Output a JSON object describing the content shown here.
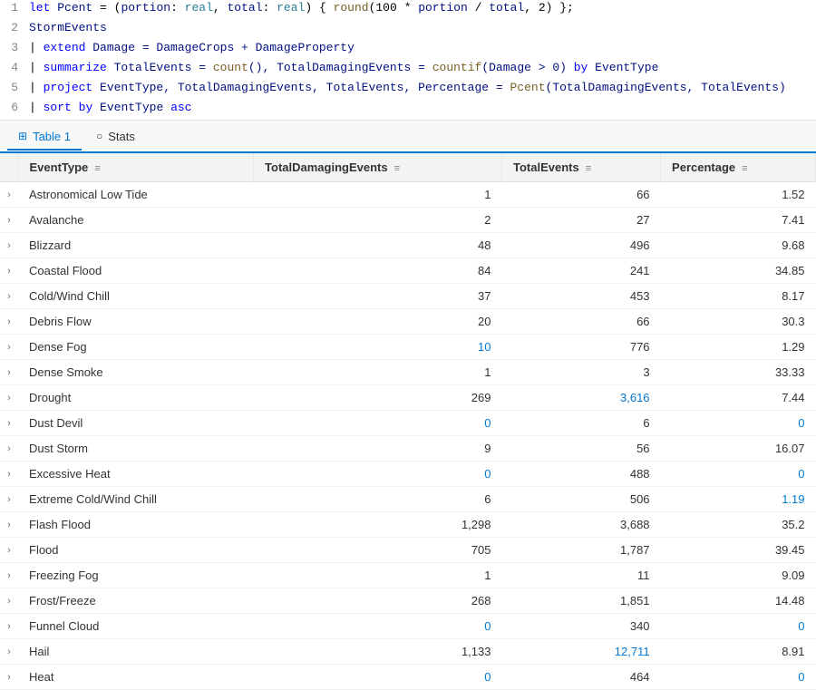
{
  "editor": {
    "lines": [
      {
        "num": 1,
        "tokens": [
          {
            "text": "let ",
            "cls": "keyword"
          },
          {
            "text": "Pcent",
            "cls": "identifier"
          },
          {
            "text": " = (",
            "cls": "op"
          },
          {
            "text": "portion",
            "cls": "param"
          },
          {
            "text": ": ",
            "cls": "op"
          },
          {
            "text": "real",
            "cls": "type"
          },
          {
            "text": ", ",
            "cls": "op"
          },
          {
            "text": "total",
            "cls": "param"
          },
          {
            "text": ": ",
            "cls": "op"
          },
          {
            "text": "real",
            "cls": "type"
          },
          {
            "text": ") { ",
            "cls": "op"
          },
          {
            "text": "round",
            "cls": "fn"
          },
          {
            "text": "(100 * ",
            "cls": "op"
          },
          {
            "text": "portion",
            "cls": "param"
          },
          {
            "text": " / ",
            "cls": "op"
          },
          {
            "text": "total",
            "cls": "param"
          },
          {
            "text": ", 2) };",
            "cls": "op"
          }
        ]
      },
      {
        "num": 2,
        "tokens": [
          {
            "text": "StormEvents",
            "cls": "identifier"
          }
        ]
      },
      {
        "num": 3,
        "tokens": [
          {
            "text": "| ",
            "cls": "pipe"
          },
          {
            "text": "extend",
            "cls": "keyword"
          },
          {
            "text": " Damage = DamageCrops + DamageProperty",
            "cls": "identifier"
          }
        ]
      },
      {
        "num": 4,
        "tokens": [
          {
            "text": "| ",
            "cls": "pipe"
          },
          {
            "text": "summarize",
            "cls": "keyword"
          },
          {
            "text": " TotalEvents = ",
            "cls": "identifier"
          },
          {
            "text": "count",
            "cls": "fn"
          },
          {
            "text": "(), TotalDamagingEvents = ",
            "cls": "identifier"
          },
          {
            "text": "countif",
            "cls": "fn"
          },
          {
            "text": "(Damage > 0) ",
            "cls": "identifier"
          },
          {
            "text": "by",
            "cls": "keyword"
          },
          {
            "text": " EventType",
            "cls": "identifier"
          }
        ]
      },
      {
        "num": 5,
        "tokens": [
          {
            "text": "| ",
            "cls": "pipe"
          },
          {
            "text": "project",
            "cls": "keyword"
          },
          {
            "text": " EventType, TotalDamagingEvents, TotalEvents, Percentage = ",
            "cls": "identifier"
          },
          {
            "text": "Pcent",
            "cls": "fn"
          },
          {
            "text": "(TotalDamagingEvents, TotalEvents)",
            "cls": "identifier"
          }
        ]
      },
      {
        "num": 6,
        "tokens": [
          {
            "text": "| ",
            "cls": "pipe"
          },
          {
            "text": "sort",
            "cls": "keyword"
          },
          {
            "text": " ",
            "cls": "op"
          },
          {
            "text": "by",
            "cls": "keyword"
          },
          {
            "text": " EventType ",
            "cls": "identifier"
          },
          {
            "text": "asc",
            "cls": "keyword"
          }
        ]
      }
    ]
  },
  "tabs": [
    {
      "label": "Table 1",
      "icon": "⊞",
      "active": true
    },
    {
      "label": "Stats",
      "icon": "○",
      "active": false
    }
  ],
  "table": {
    "columns": [
      {
        "label": "EventType",
        "align": "left"
      },
      {
        "label": "TotalDamagingEvents",
        "align": "right"
      },
      {
        "label": "TotalEvents",
        "align": "right"
      },
      {
        "label": "Percentage",
        "align": "right"
      }
    ],
    "rows": [
      {
        "eventType": "Astronomical Low Tide",
        "totalDamaging": "1",
        "totalEvents": "66",
        "percentage": "1.52",
        "damaging_blue": false,
        "events_blue": false
      },
      {
        "eventType": "Avalanche",
        "totalDamaging": "2",
        "totalEvents": "27",
        "percentage": "7.41",
        "damaging_blue": false,
        "events_blue": false
      },
      {
        "eventType": "Blizzard",
        "totalDamaging": "48",
        "totalEvents": "496",
        "percentage": "9.68",
        "damaging_blue": false,
        "events_blue": false
      },
      {
        "eventType": "Coastal Flood",
        "totalDamaging": "84",
        "totalEvents": "241",
        "percentage": "34.85",
        "damaging_blue": false,
        "events_blue": false
      },
      {
        "eventType": "Cold/Wind Chill",
        "totalDamaging": "37",
        "totalEvents": "453",
        "percentage": "8.17",
        "damaging_blue": false,
        "events_blue": false
      },
      {
        "eventType": "Debris Flow",
        "totalDamaging": "20",
        "totalEvents": "66",
        "percentage": "30.3",
        "damaging_blue": false,
        "events_blue": false
      },
      {
        "eventType": "Dense Fog",
        "totalDamaging": "10",
        "totalEvents": "776",
        "percentage": "1.29",
        "damaging_blue": true,
        "events_blue": false
      },
      {
        "eventType": "Dense Smoke",
        "totalDamaging": "1",
        "totalEvents": "3",
        "percentage": "33.33",
        "damaging_blue": false,
        "events_blue": false
      },
      {
        "eventType": "Drought",
        "totalDamaging": "269",
        "totalEvents": "3,616",
        "percentage": "7.44",
        "damaging_blue": false,
        "events_blue": true
      },
      {
        "eventType": "Dust Devil",
        "totalDamaging": "0",
        "totalEvents": "6",
        "percentage": "0",
        "damaging_blue": true,
        "events_blue": false,
        "zero_pct": true
      },
      {
        "eventType": "Dust Storm",
        "totalDamaging": "9",
        "totalEvents": "56",
        "percentage": "16.07",
        "damaging_blue": false,
        "events_blue": false
      },
      {
        "eventType": "Excessive Heat",
        "totalDamaging": "0",
        "totalEvents": "488",
        "percentage": "0",
        "damaging_blue": true,
        "events_blue": false,
        "zero_pct": true
      },
      {
        "eventType": "Extreme Cold/Wind Chill",
        "totalDamaging": "6",
        "totalEvents": "506",
        "percentage": "1.19",
        "damaging_blue": false,
        "events_blue": false,
        "pct_blue": true
      },
      {
        "eventType": "Flash Flood",
        "totalDamaging": "1,298",
        "totalEvents": "3,688",
        "percentage": "35.2",
        "damaging_blue": false,
        "events_blue": false
      },
      {
        "eventType": "Flood",
        "totalDamaging": "705",
        "totalEvents": "1,787",
        "percentage": "39.45",
        "damaging_blue": false,
        "events_blue": false
      },
      {
        "eventType": "Freezing Fog",
        "totalDamaging": "1",
        "totalEvents": "11",
        "percentage": "9.09",
        "damaging_blue": false,
        "events_blue": false
      },
      {
        "eventType": "Frost/Freeze",
        "totalDamaging": "268",
        "totalEvents": "1,851",
        "percentage": "14.48",
        "damaging_blue": false,
        "events_blue": false
      },
      {
        "eventType": "Funnel Cloud",
        "totalDamaging": "0",
        "totalEvents": "340",
        "percentage": "0",
        "damaging_blue": true,
        "events_blue": false,
        "zero_pct": true
      },
      {
        "eventType": "Hail",
        "totalDamaging": "1,133",
        "totalEvents": "12,711",
        "percentage": "8.91",
        "damaging_blue": false,
        "events_blue": true
      },
      {
        "eventType": "Heat",
        "totalDamaging": "0",
        "totalEvents": "464",
        "percentage": "0",
        "damaging_blue": true,
        "events_blue": false,
        "zero_pct": true
      }
    ]
  }
}
